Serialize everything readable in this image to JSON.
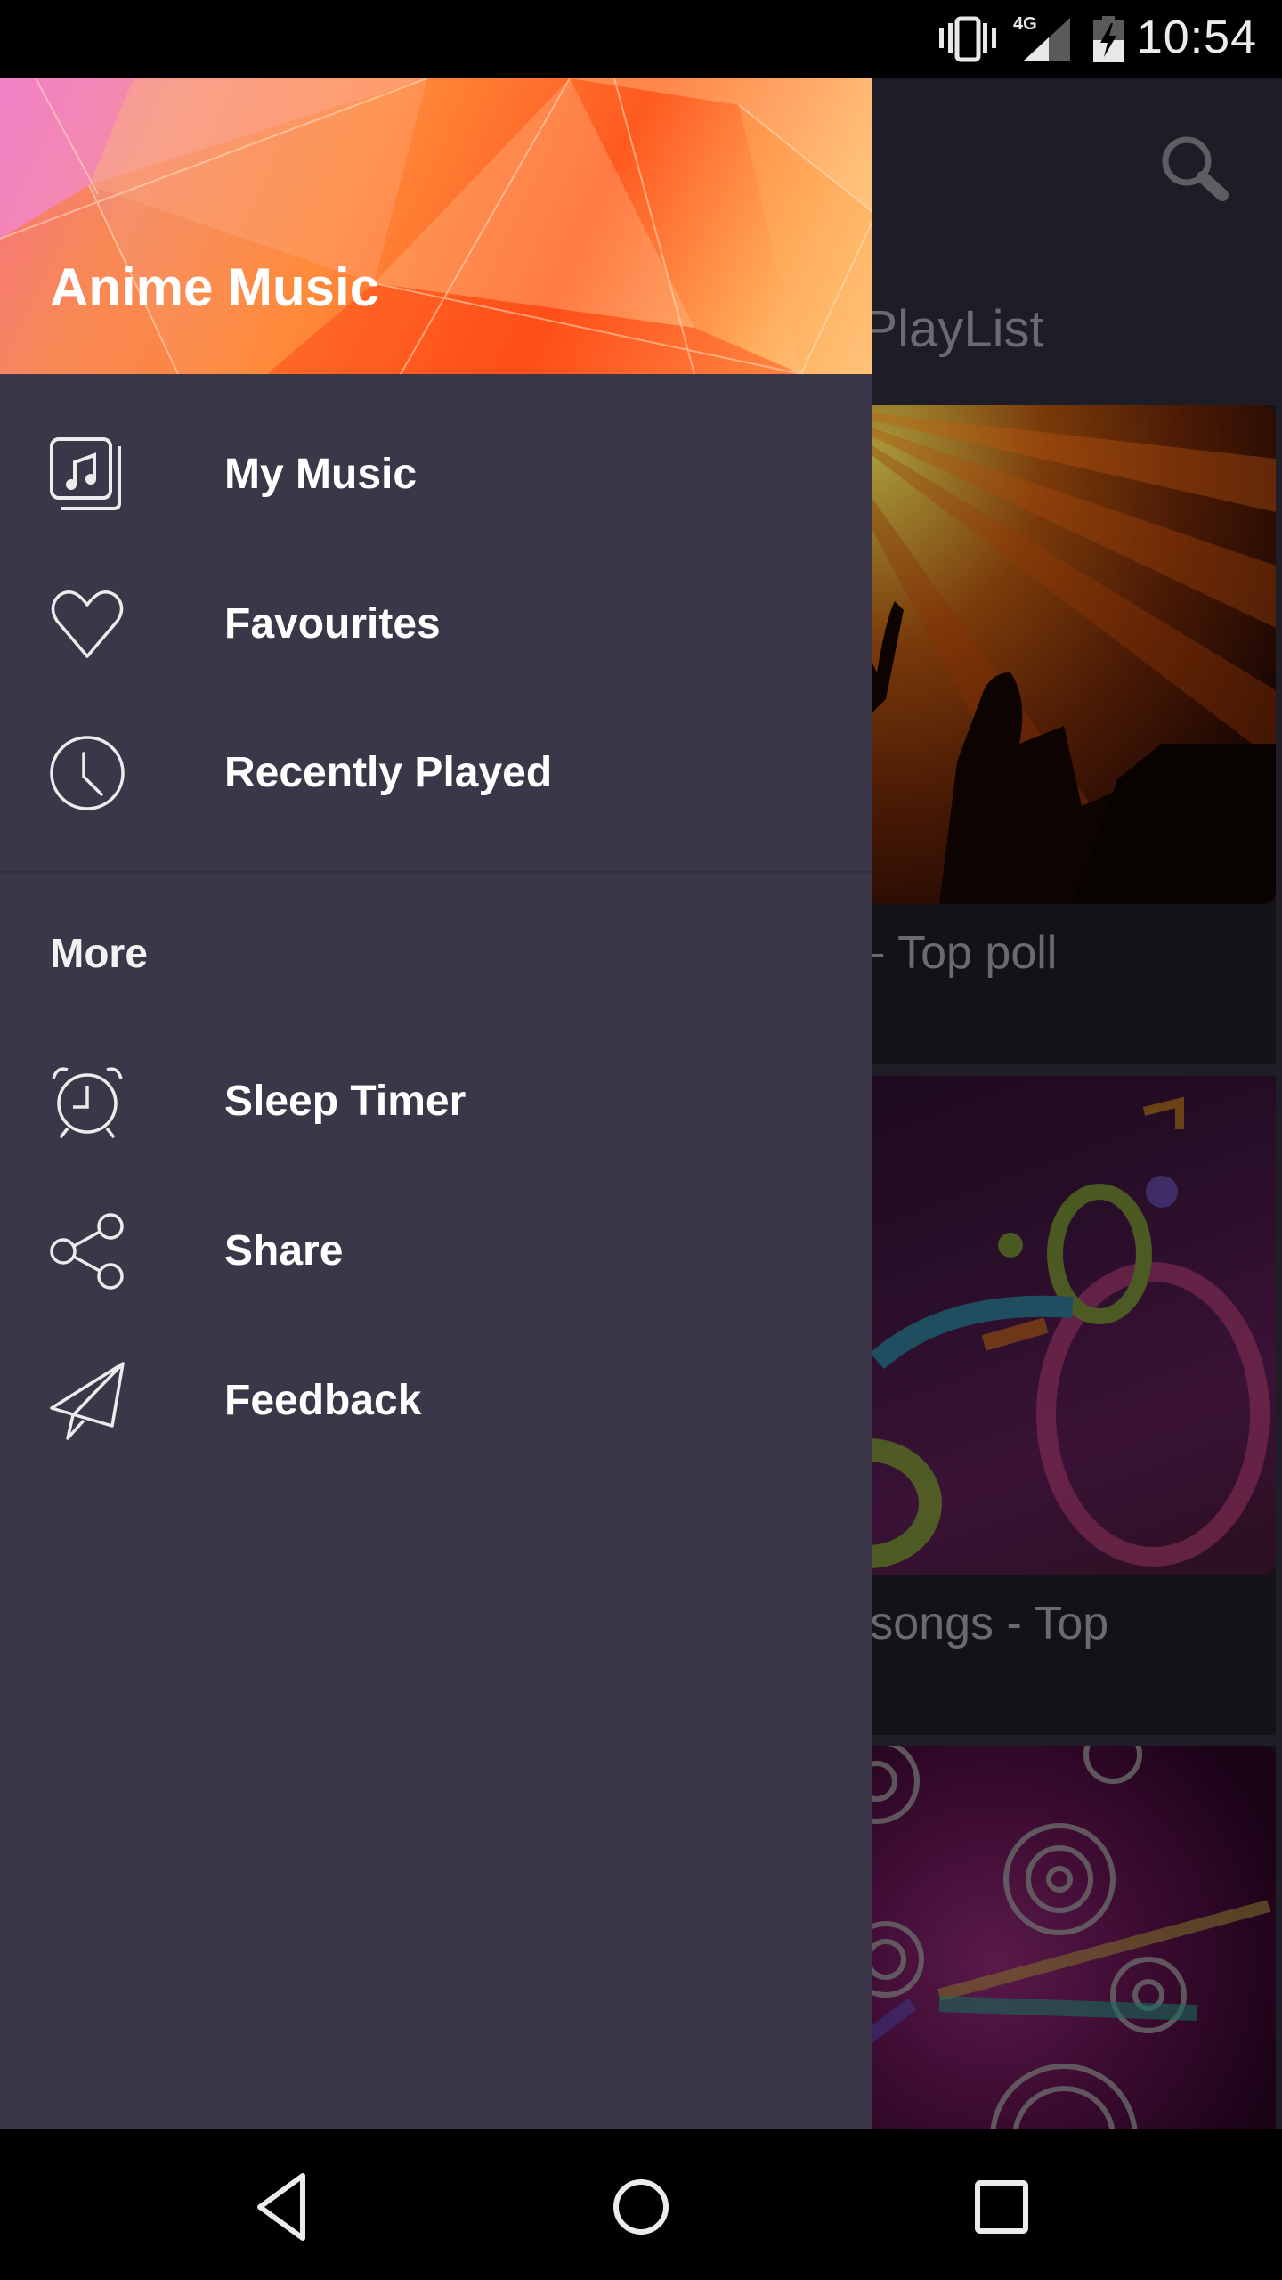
{
  "status_bar": {
    "time": "10:54",
    "network": "4G",
    "icons": [
      "vibrate-icon",
      "signal-4g-icon",
      "battery-charging-icon"
    ]
  },
  "app": {
    "search_icon": "search-icon",
    "tab_title": "ot PlayList",
    "cards": [
      {
        "title": "ne - Top poll",
        "image": "concert-silhouette-image"
      },
      {
        "title": "ne songs - Top",
        "image": "colorful-music-notes-image"
      },
      {
        "title": "",
        "image": "neon-circles-image"
      }
    ]
  },
  "drawer": {
    "header_title": "Anime Music",
    "primary_items": [
      {
        "label": "My Music",
        "icon": "music-library-icon"
      },
      {
        "label": "Favourites",
        "icon": "heart-icon"
      },
      {
        "label": "Recently Played",
        "icon": "clock-icon"
      }
    ],
    "section_label": "More",
    "secondary_items": [
      {
        "label": "Sleep Timer",
        "icon": "alarm-clock-icon"
      },
      {
        "label": "Share",
        "icon": "share-icon"
      },
      {
        "label": "Feedback",
        "icon": "paper-plane-icon"
      }
    ]
  },
  "nav_bar": {
    "buttons": [
      "back",
      "home",
      "recents"
    ]
  },
  "colors": {
    "drawer_bg": "#3b3749",
    "app_bg": "#1f1e27",
    "badge": "#6d0b22",
    "header_accent": "#ff5a20"
  }
}
